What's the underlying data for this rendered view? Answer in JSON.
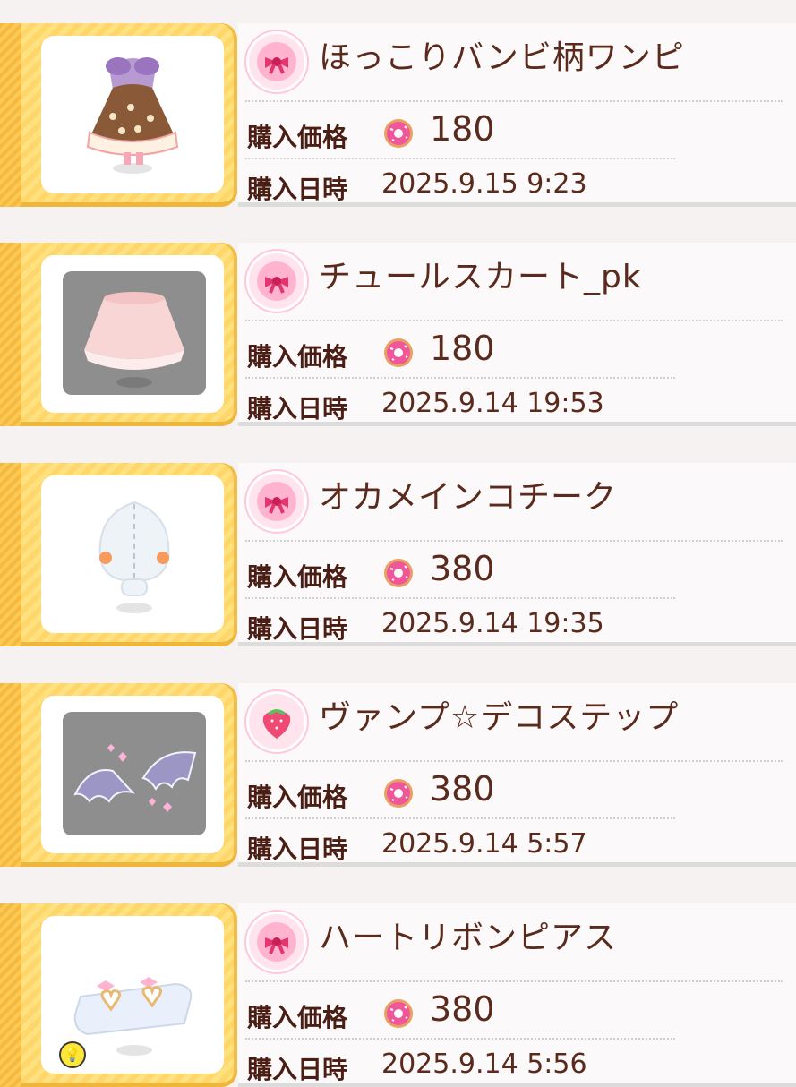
{
  "labels": {
    "price_label": "購入価格",
    "date_label": "購入日時"
  },
  "hint_icon": "lightbulb-icon",
  "currency_icon": "donut-icon",
  "items": [
    {
      "name": "ほっこりバンビ柄ワンピ",
      "price": "180",
      "date": "2025.9.15 9:23",
      "badge": "ribbon-icon",
      "thumbnail": "dress-icon"
    },
    {
      "name": "チュールスカート_pk",
      "price": "180",
      "date": "2025.9.14 19:53",
      "badge": "ribbon-icon",
      "thumbnail": "skirt-icon"
    },
    {
      "name": "オカメインコチーク",
      "price": "380",
      "date": "2025.9.14 19:35",
      "badge": "ribbon-icon",
      "thumbnail": "blush-icon"
    },
    {
      "name": "ヴァンプ☆デコステップ",
      "price": "380",
      "date": "2025.9.14 5:57",
      "badge": "strawberry-icon",
      "thumbnail": "wings-icon"
    },
    {
      "name": "ハートリボンピアス",
      "price": "380",
      "date": "2025.9.14 5:56",
      "badge": "ribbon-icon",
      "thumbnail": "earrings-icon"
    }
  ]
}
